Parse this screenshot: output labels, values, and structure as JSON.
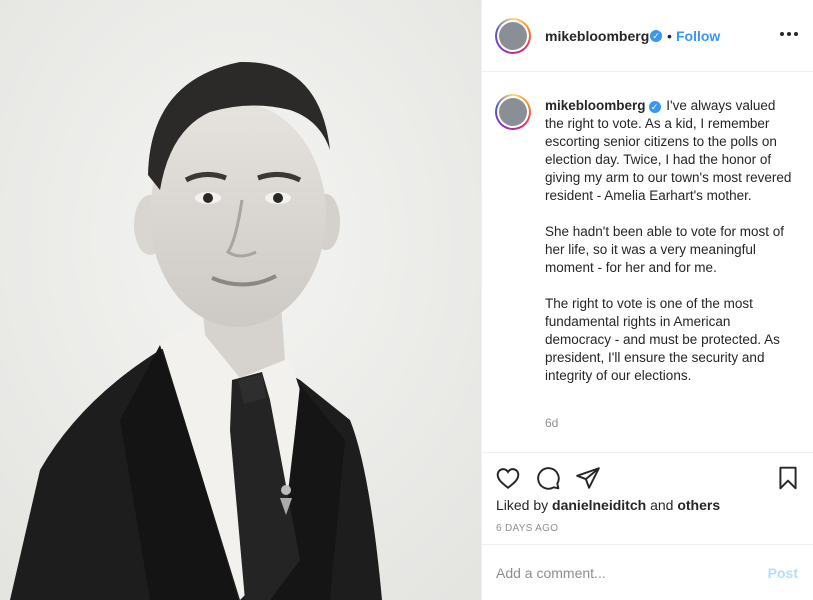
{
  "post": {
    "username": "mikebloomberg",
    "verified_icon": "verified-badge-icon",
    "follow_label": "Follow",
    "separator": "•",
    "caption_paragraphs": [
      "I've always valued the right to vote. As a kid, I remember escorting senior citizens to the polls on election day. Twice, I had the honor of giving my arm to our town's most revered resident - Amelia Earhart's mother.",
      "She hadn't been able to vote for most of her life, so it was a very meaningful moment - for her and for me.",
      "The right to vote is one of the most fundamental rights in American democracy - and must be protected. As president, I'll ensure the security and integrity of our elections."
    ],
    "age": "6d",
    "likes": {
      "prefix": "Liked by",
      "user": "danielneiditch",
      "and": "and",
      "others": "others"
    },
    "date": "6 DAYS AGO",
    "comment_placeholder": "Add a comment...",
    "post_label": "Post",
    "colors": {
      "accent": "#3897f0",
      "post_disabled": "#b2dffc",
      "muted": "#8e8e8e",
      "text": "#262626"
    }
  }
}
